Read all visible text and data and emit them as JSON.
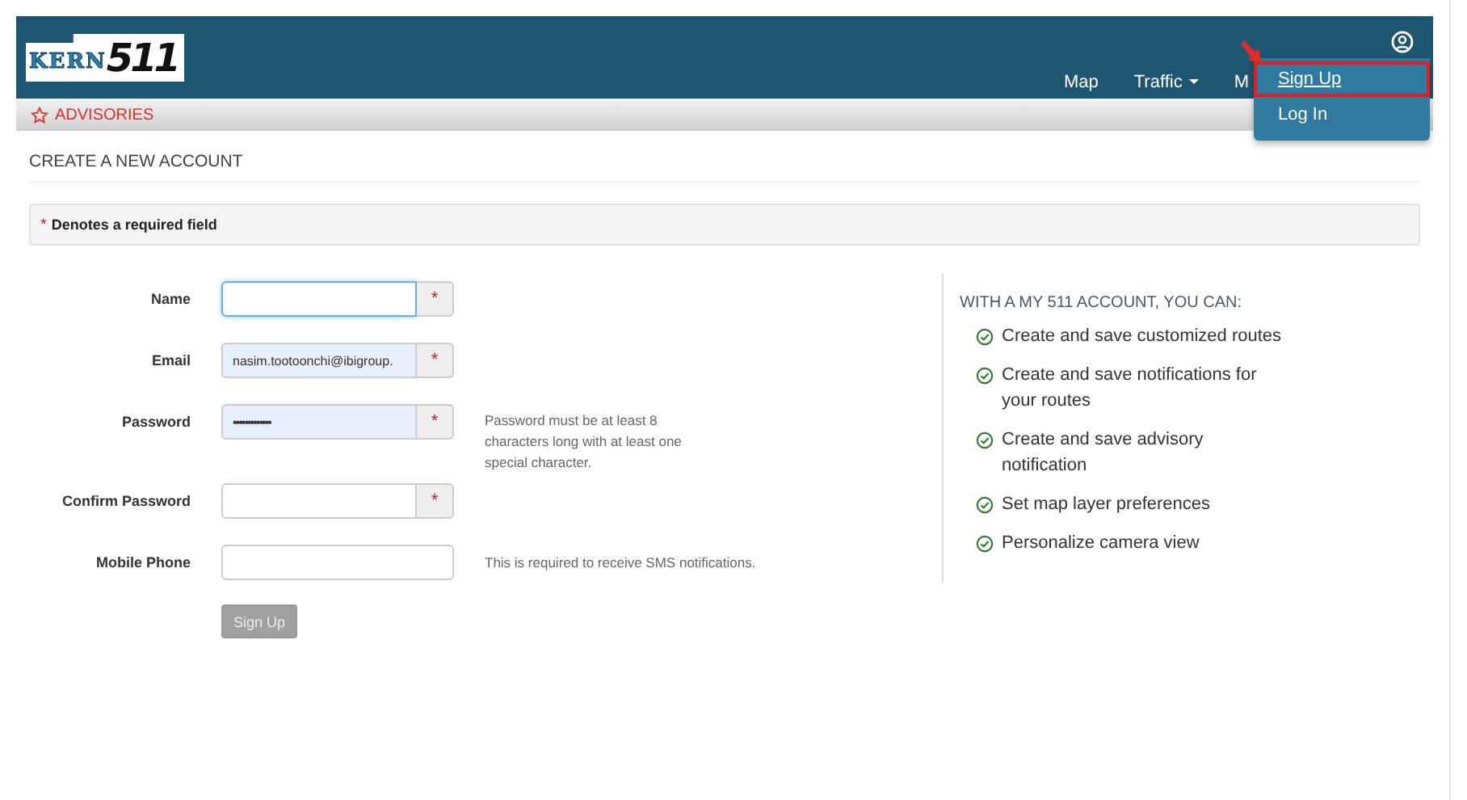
{
  "header": {
    "logo": {
      "word": "KERN",
      "number": "511"
    },
    "nav": [
      {
        "label": "Map",
        "dropdown": false
      },
      {
        "label": "Traffic",
        "dropdown": true
      },
      {
        "label": "M",
        "dropdown": false
      }
    ],
    "user_menu": {
      "expanded": true,
      "items": [
        {
          "label": "Sign Up",
          "selected": true
        },
        {
          "label": "Log In",
          "selected": false
        }
      ]
    }
  },
  "advisories": {
    "label": "ADVISORIES"
  },
  "page_title": "CREATE A NEW ACCOUNT",
  "required_note": {
    "mark": "*",
    "text": "Denotes a required field"
  },
  "form": {
    "fields": [
      {
        "label": "Name",
        "kind": "text",
        "focused": true,
        "autofilled": false,
        "required": true
      },
      {
        "label": "Email",
        "kind": "text",
        "value": "nasim.tootoonchi@ibigroup.",
        "focused": false,
        "autofilled": true,
        "required": true
      },
      {
        "label": "Password",
        "kind": "password",
        "value": "•••••••••••••",
        "focused": false,
        "autofilled": true,
        "required": true,
        "hint": "Password must be at least 8 characters long with at least one special character."
      },
      {
        "label": "Confirm Password",
        "kind": "password",
        "focused": false,
        "autofilled": false,
        "required": true
      },
      {
        "label": "Mobile Phone",
        "kind": "text",
        "focused": false,
        "autofilled": false,
        "required": false,
        "hint": "This is required to receive SMS notifications."
      }
    ],
    "submit": {
      "label": "Sign Up",
      "disabled": true
    }
  },
  "benefits": {
    "title": "WITH A MY 511 ACCOUNT, YOU CAN:",
    "items": [
      "Create and save customized routes",
      "Create and save notifications for your routes",
      "Create and save advisory notification",
      "Set map layer preferences",
      "Personalize camera view"
    ]
  }
}
